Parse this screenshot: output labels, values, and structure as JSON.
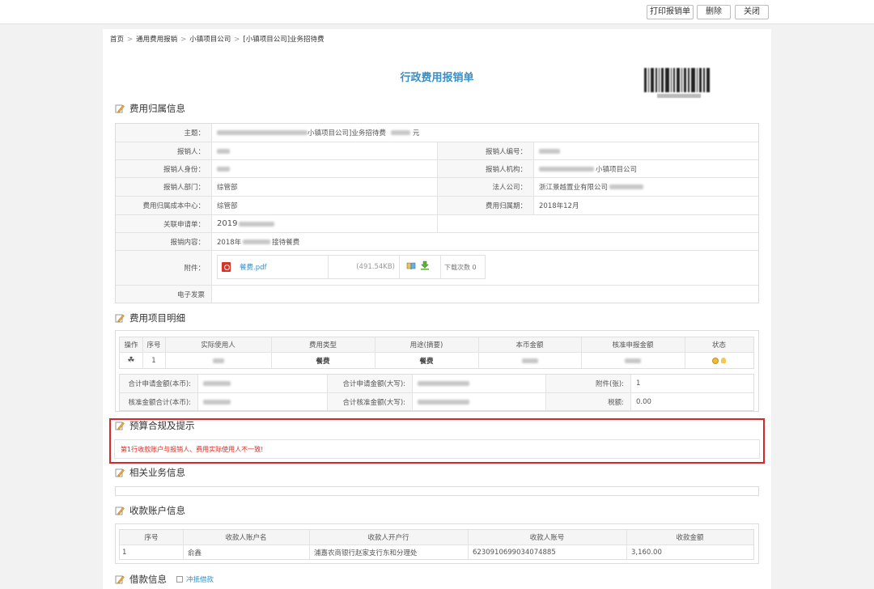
{
  "toolbar": {
    "print_label": "打印报销单",
    "delete_label": "删除",
    "close_label": "关闭"
  },
  "breadcrumb": [
    "首页",
    "通用费用报销",
    "小镇项目公司",
    "[小镇项目公司]业务招待费"
  ],
  "doc_title": "行政费用报销单",
  "sections": {
    "attribution": "费用归属信息",
    "items": "费用项目明细",
    "budget": "预算合规及提示",
    "related": "相关业务信息",
    "receiving": "收款账户信息",
    "loan": "借款信息"
  },
  "attribution": {
    "subject_label": "主题：",
    "subject_value": "小镇项目公司]业务招待费",
    "subject_suffix": "元",
    "applicant_label": "报销人：",
    "applicant_no_label": "报销人编号：",
    "identity_label": "报销人身份：",
    "org_label": "报销人机构：",
    "org_value": "小镇项目公司",
    "dept_label": "报销人部门：",
    "dept_value": "综管部",
    "legal_label": "法人公司：",
    "legal_value": "浙江景越置业有限公司",
    "cost_center_label": "费用归属成本中心：",
    "cost_center_value": "综管部",
    "period_label": "费用归属期：",
    "period_value": "2018年12月",
    "related_req_label": "关联申请单：",
    "related_req_value": "2019",
    "content_label": "报销内容：",
    "content_prefix": "2018年",
    "content_suffix": "接待餐费",
    "attachment_label": "附件：",
    "attachment_file": "餐费.pdf",
    "attachment_size": "(491.54KB)",
    "download_label": "下载次数",
    "download_count": "0",
    "einvoice_label": "电子发票"
  },
  "items_table": {
    "headers": [
      "操作",
      "序号",
      "实际使用人",
      "费用类型",
      "用途(摘要)",
      "本币金额",
      "核准申报金额",
      "状态"
    ],
    "row": {
      "seq": "1",
      "type": "餐费",
      "purpose": "餐费"
    }
  },
  "totals": {
    "apply_amount_label": "合计申请金额(本币):",
    "apply_upper_label": "合计申请金额(大写):",
    "attachments_label": "附件(张):",
    "attachments_value": "1",
    "approved_amount_label": "核准金额合计(本币):",
    "approved_upper_label": "合计核准金额(大写):",
    "tax_label": "税额:",
    "tax_value": "0.00"
  },
  "budget_warning": "第1行收款账户与报销人、费用实际使用人不一致!",
  "receiving_table": {
    "headers": [
      "序号",
      "收款人账户名",
      "收款人开户行",
      "收款人账号",
      "收款金额"
    ],
    "row": {
      "seq": "1",
      "name": "俞鑫",
      "bank": "浦嘉农商银行赵家支行东和分理处",
      "account": "6230910699034074885",
      "amount": "3,160.00"
    }
  },
  "loan": {
    "offset_label": "冲抵借款"
  },
  "colors": {
    "accent": "#3a8fc5",
    "warning": "#e0261f",
    "highlight_border": "#d9262b"
  }
}
